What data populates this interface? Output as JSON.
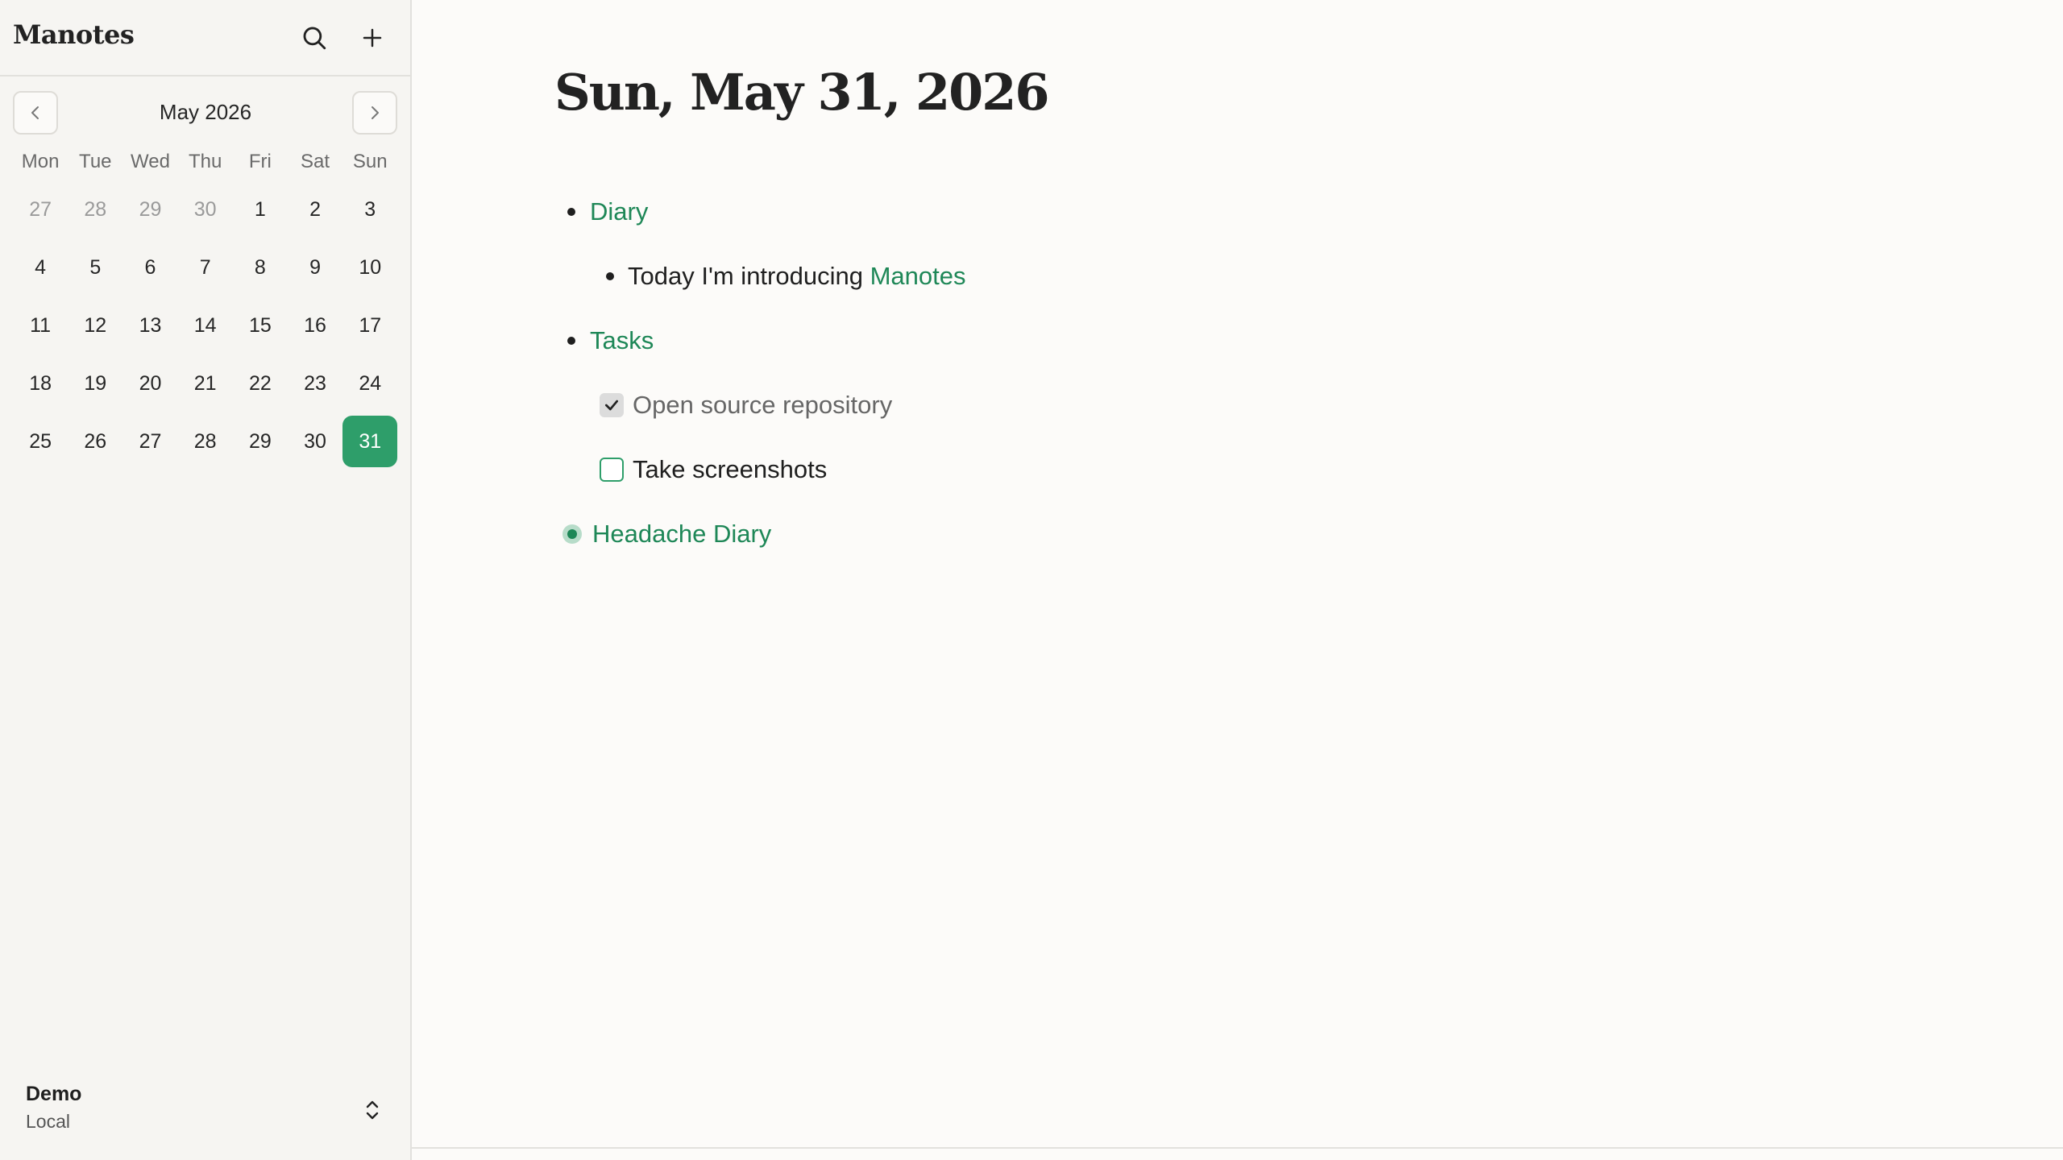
{
  "sidebar": {
    "app_title": "Manotes",
    "search_icon": "search-icon",
    "add_icon": "plus-icon",
    "calendar": {
      "month_label": "May 2026",
      "weekdays": [
        "Mon",
        "Tue",
        "Wed",
        "Thu",
        "Fri",
        "Sat",
        "Sun"
      ],
      "days": [
        {
          "label": "27",
          "muted": true
        },
        {
          "label": "28",
          "muted": true
        },
        {
          "label": "29",
          "muted": true
        },
        {
          "label": "30",
          "muted": true
        },
        {
          "label": "1"
        },
        {
          "label": "2"
        },
        {
          "label": "3"
        },
        {
          "label": "4"
        },
        {
          "label": "5"
        },
        {
          "label": "6"
        },
        {
          "label": "7"
        },
        {
          "label": "8"
        },
        {
          "label": "9"
        },
        {
          "label": "10"
        },
        {
          "label": "11"
        },
        {
          "label": "12"
        },
        {
          "label": "13"
        },
        {
          "label": "14"
        },
        {
          "label": "15"
        },
        {
          "label": "16"
        },
        {
          "label": "17"
        },
        {
          "label": "18"
        },
        {
          "label": "19"
        },
        {
          "label": "20"
        },
        {
          "label": "21"
        },
        {
          "label": "22"
        },
        {
          "label": "23"
        },
        {
          "label": "24"
        },
        {
          "label": "25"
        },
        {
          "label": "26"
        },
        {
          "label": "27"
        },
        {
          "label": "28"
        },
        {
          "label": "29"
        },
        {
          "label": "30"
        },
        {
          "label": "31",
          "selected": true
        }
      ],
      "accent_color": "#2e9e6a"
    },
    "workspace": {
      "name": "Demo",
      "location": "Local"
    }
  },
  "main": {
    "page_title": "Sun, May 31, 2026",
    "outline": {
      "diary_link": "Diary",
      "intro_text": "Today I'm introducing ",
      "intro_link": "Manotes",
      "tasks_link": "Tasks",
      "task_1": {
        "label": "Open source repository",
        "done": true
      },
      "task_2": {
        "label": "Take screenshots",
        "done": false
      },
      "headache_link": "Headache Diary"
    },
    "link_color": "#1e8757"
  }
}
